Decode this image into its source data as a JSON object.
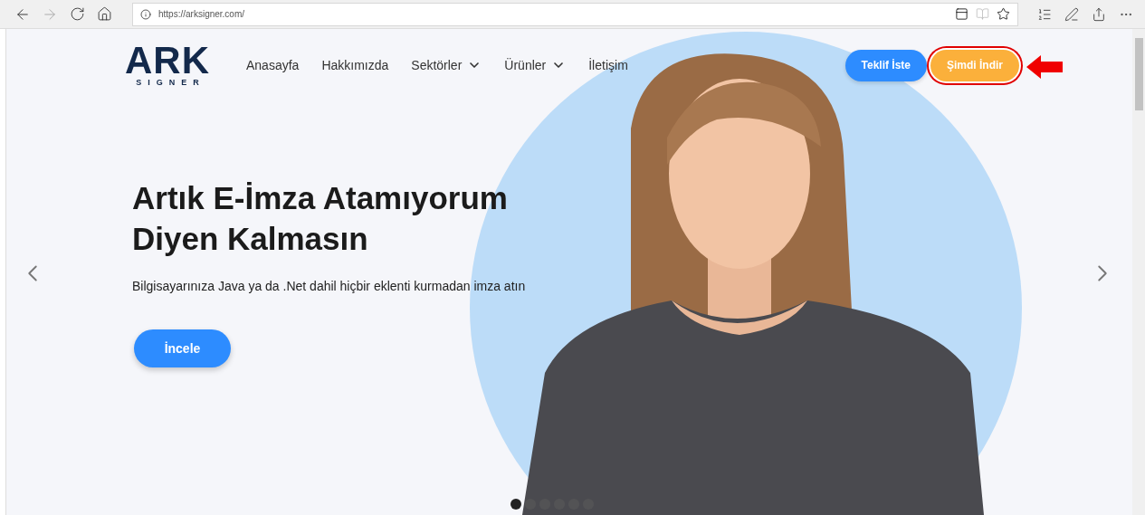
{
  "browser": {
    "url": "https://arksigner.com/"
  },
  "logo": {
    "name": "ARK",
    "tagline": "SIGNER"
  },
  "nav": [
    {
      "label": "Anasayfa",
      "dropdown": false
    },
    {
      "label": "Hakkımızda",
      "dropdown": false
    },
    {
      "label": "Sektörler",
      "dropdown": true
    },
    {
      "label": "Ürünler",
      "dropdown": true
    },
    {
      "label": "İletişim",
      "dropdown": false
    }
  ],
  "actions": [
    {
      "label": "Teklif İste",
      "kind": "primary",
      "highlighted": false
    },
    {
      "label": "Şimdi İndir",
      "kind": "download",
      "highlighted": true
    }
  ],
  "hero": {
    "title": "Artık E-İmza Atamıyorum\nDiyen Kalmasın",
    "subtitle": "Bilgisayarınıza Java ya da .Net dahil hiçbir eklenti kurmadan imza atın",
    "cta": "İncele"
  },
  "carousel_dots": [
    {
      "selected": true
    },
    {
      "selected": false
    },
    {
      "selected": false
    },
    {
      "selected": false
    },
    {
      "selected": false
    },
    {
      "selected": false
    }
  ]
}
